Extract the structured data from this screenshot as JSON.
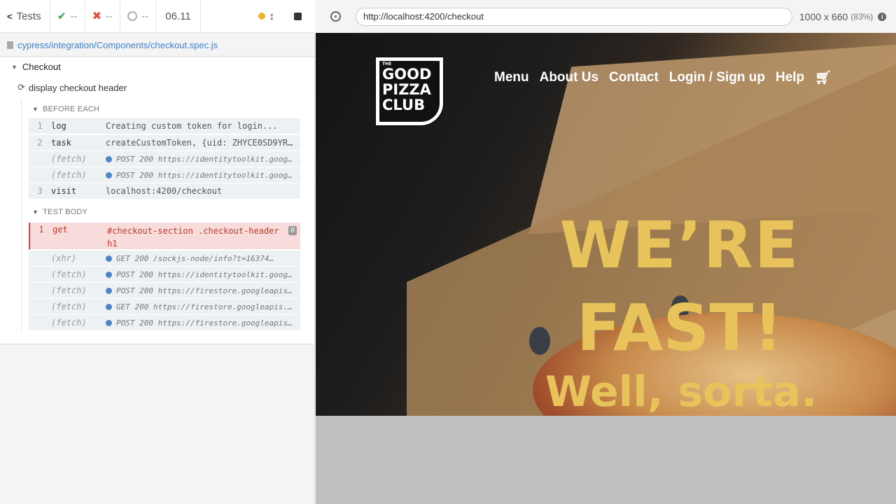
{
  "reporter": {
    "tests_label": "Tests",
    "passed": "--",
    "failed": "--",
    "pending": "--",
    "duration": "06.11",
    "spec_path": "cypress/integration/Components/checkout.spec.js",
    "suite_title": "Checkout",
    "test_title": "display checkout header",
    "before_each_label": "BEFORE EACH",
    "test_body_label": "TEST BODY",
    "before_each_commands": [
      {
        "num": "1",
        "name": "log",
        "msg": "Creating custom token for login..."
      },
      {
        "num": "2",
        "name": "task",
        "msg": "createCustomToken, {uid: ZHYCE0SD9YR…"
      },
      {
        "num": "",
        "name": "(fetch)",
        "msg": "POST 200 https://identitytoolkit.googlea…"
      },
      {
        "num": "",
        "name": "(fetch)",
        "msg": "POST 200 https://identitytoolkit.googlea…"
      },
      {
        "num": "3",
        "name": "visit",
        "msg": "localhost:4200/checkout"
      }
    ],
    "test_body_commands": [
      {
        "num": "1",
        "name": "get",
        "msg": "#checkout-section .checkout-header h1",
        "badge": "0"
      },
      {
        "num": "",
        "name": "(xhr)",
        "msg": "GET 200 /sockjs-node/info?t=16374…"
      },
      {
        "num": "",
        "name": "(fetch)",
        "msg": "POST 200 https://identitytoolkit.googlea…"
      },
      {
        "num": "",
        "name": "(fetch)",
        "msg": "POST 200 https://firestore.googleapis.co…"
      },
      {
        "num": "",
        "name": "(fetch)",
        "msg": "GET 200 https://firestore.googleapis.com…"
      },
      {
        "num": "",
        "name": "(fetch)",
        "msg": "POST 200 https://firestore.googleapis.co…"
      }
    ]
  },
  "aut": {
    "url": "http://localhost:4200/checkout",
    "viewport": "1000 x 660",
    "scale": "(83%)",
    "site": {
      "logo_small": "THE",
      "logo_lines": [
        "GOOD",
        "PIZZA",
        "CLUB"
      ],
      "nav": [
        "Menu",
        "About Us",
        "Contact",
        "Login / Sign up",
        "Help"
      ],
      "hero_line1": "WE’RE",
      "hero_line2": "FAST!",
      "hero_sub": "Well, sorta."
    }
  },
  "colors": {
    "pass": "#2e9e49",
    "fail": "#e3513e",
    "link": "#3b7fd6",
    "hero_yellow": "#e8c35c"
  }
}
